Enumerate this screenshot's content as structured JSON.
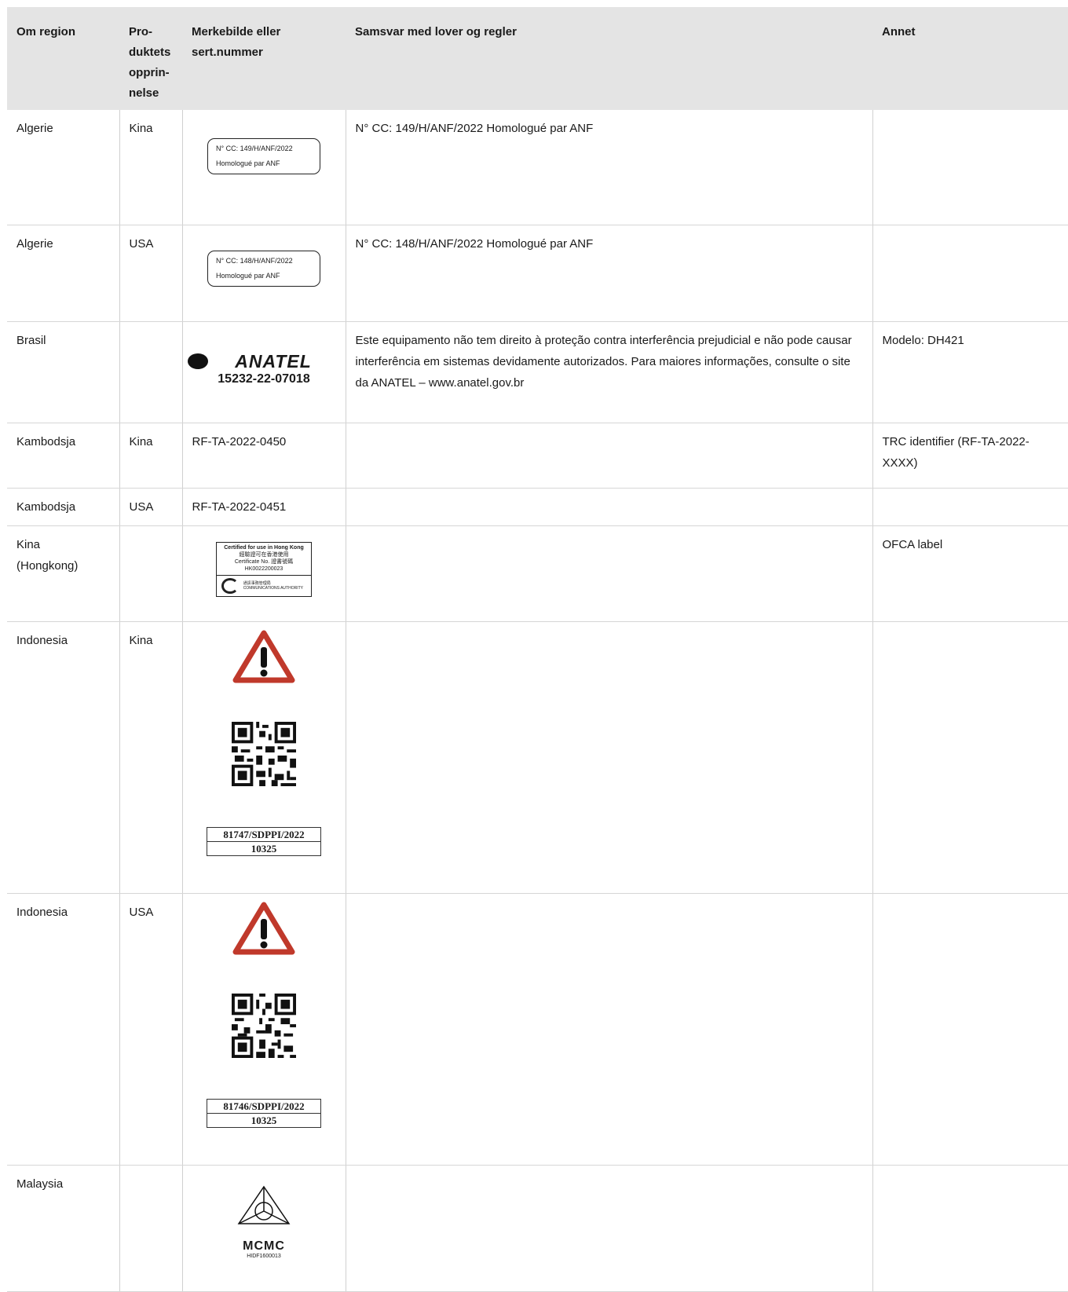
{
  "headers": {
    "region": "Om region",
    "origin": "Pro-\nduktets\nopprin-\nnelse",
    "mark": "Merkebilde eller\nsert.nummer",
    "compliance": "Samsvar med lover og regler",
    "other": "Annet"
  },
  "rows": [
    {
      "region": "Algerie",
      "origin": "Kina",
      "mark_line1": "N° CC: 149/H/ANF/2022",
      "mark_line2": "Homologué par ANF",
      "compliance": "N° CC: 149/H/ANF/2022 Homologué par ANF",
      "other": ""
    },
    {
      "region": "Algerie",
      "origin": "USA",
      "mark_line1": "N° CC: 148/H/ANF/2022",
      "mark_line2": "Homologué par ANF",
      "compliance": "N° CC: 148/H/ANF/2022 Homologué par ANF",
      "other": ""
    },
    {
      "region": "Brasil",
      "origin": "",
      "mark_logo": "ANATEL",
      "mark_number": "15232-22-07018",
      "compliance": "Este equipamento não tem direito à proteção contra interferência prejudicial e não pode causar interferência em sistemas devidamente autorizados. Para mai­o­res informações, consulte o site da ANATEL – www.anatel.gov.br",
      "other": "Modelo: DH421"
    },
    {
      "region": "Kambodsja",
      "origin": "Kina",
      "mark_text": "RF-TA-2022-0450",
      "compliance": "",
      "other": "TRC identifier (RF-TA-2022-XXXX)"
    },
    {
      "region": "Kambodsja",
      "origin": "USA",
      "mark_text": "RF-TA-2022-0451",
      "compliance": "",
      "other": ""
    },
    {
      "region": "Kina\n(Hongkong)",
      "origin": "",
      "ofca_title": "Certified for use in Hong Kong",
      "ofca_cn": "經驗證可在香港使用",
      "ofca_cert": "Certificate No. 證書號碼",
      "ofca_no": "HK0022200023",
      "ofca_auth": "通訊事務管理局 COMMUNICATIONS AUTHORITY",
      "compliance": "",
      "other": "OFCA label"
    },
    {
      "region": "Indonesia",
      "origin": "Kina",
      "sdppi1": "81747/SDPPI/2022",
      "sdppi2": "10325",
      "compliance": "",
      "other": ""
    },
    {
      "region": "Indonesia",
      "origin": "USA",
      "sdppi1": "81746/SDPPI/2022",
      "sdppi2": "10325",
      "compliance": "",
      "other": ""
    },
    {
      "region": "Malaysia",
      "origin": "",
      "mcmc": "MCMC",
      "mcmc_code": "HIDF1600013",
      "compliance": "",
      "other": ""
    }
  ]
}
